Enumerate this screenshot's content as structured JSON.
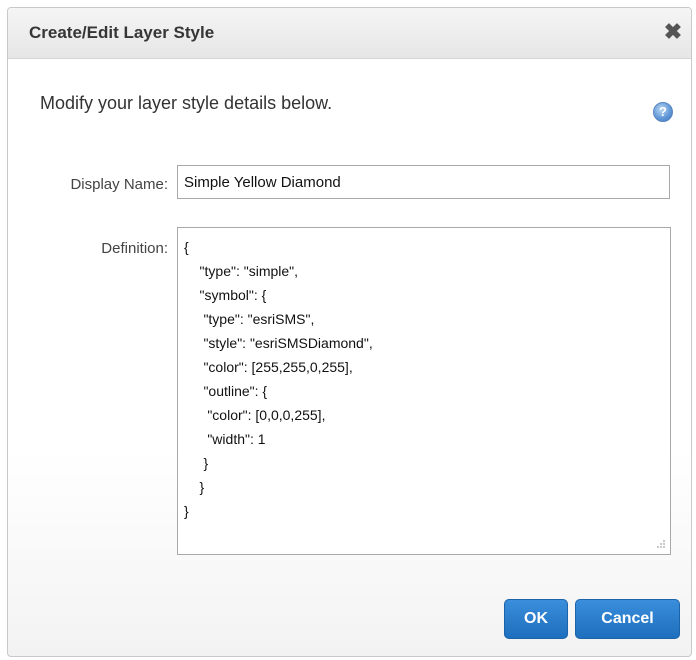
{
  "dialog": {
    "title": "Create/Edit Layer Style",
    "close_glyph": "✖",
    "intro_text": "Modify your layer style details below.",
    "help_icon": "help-icon",
    "help_glyph": "?"
  },
  "form": {
    "display_name_label": "Display Name:",
    "display_name_value": "Simple Yellow Diamond",
    "definition_label": "Definition:",
    "definition_value": "{\n    \"type\": \"simple\",\n    \"symbol\": {\n     \"type\": \"esriSMS\",\n     \"style\": \"esriSMSDiamond\",\n     \"color\": [255,255,0,255],\n     \"outline\": {\n      \"color\": [0,0,0,255],\n      \"width\": 1\n     }\n    }\n}"
  },
  "buttons": {
    "ok_label": "OK",
    "cancel_label": "Cancel"
  },
  "colors": {
    "primary_button": "#1e6fbd",
    "title_bar": "#e6e6e6"
  }
}
